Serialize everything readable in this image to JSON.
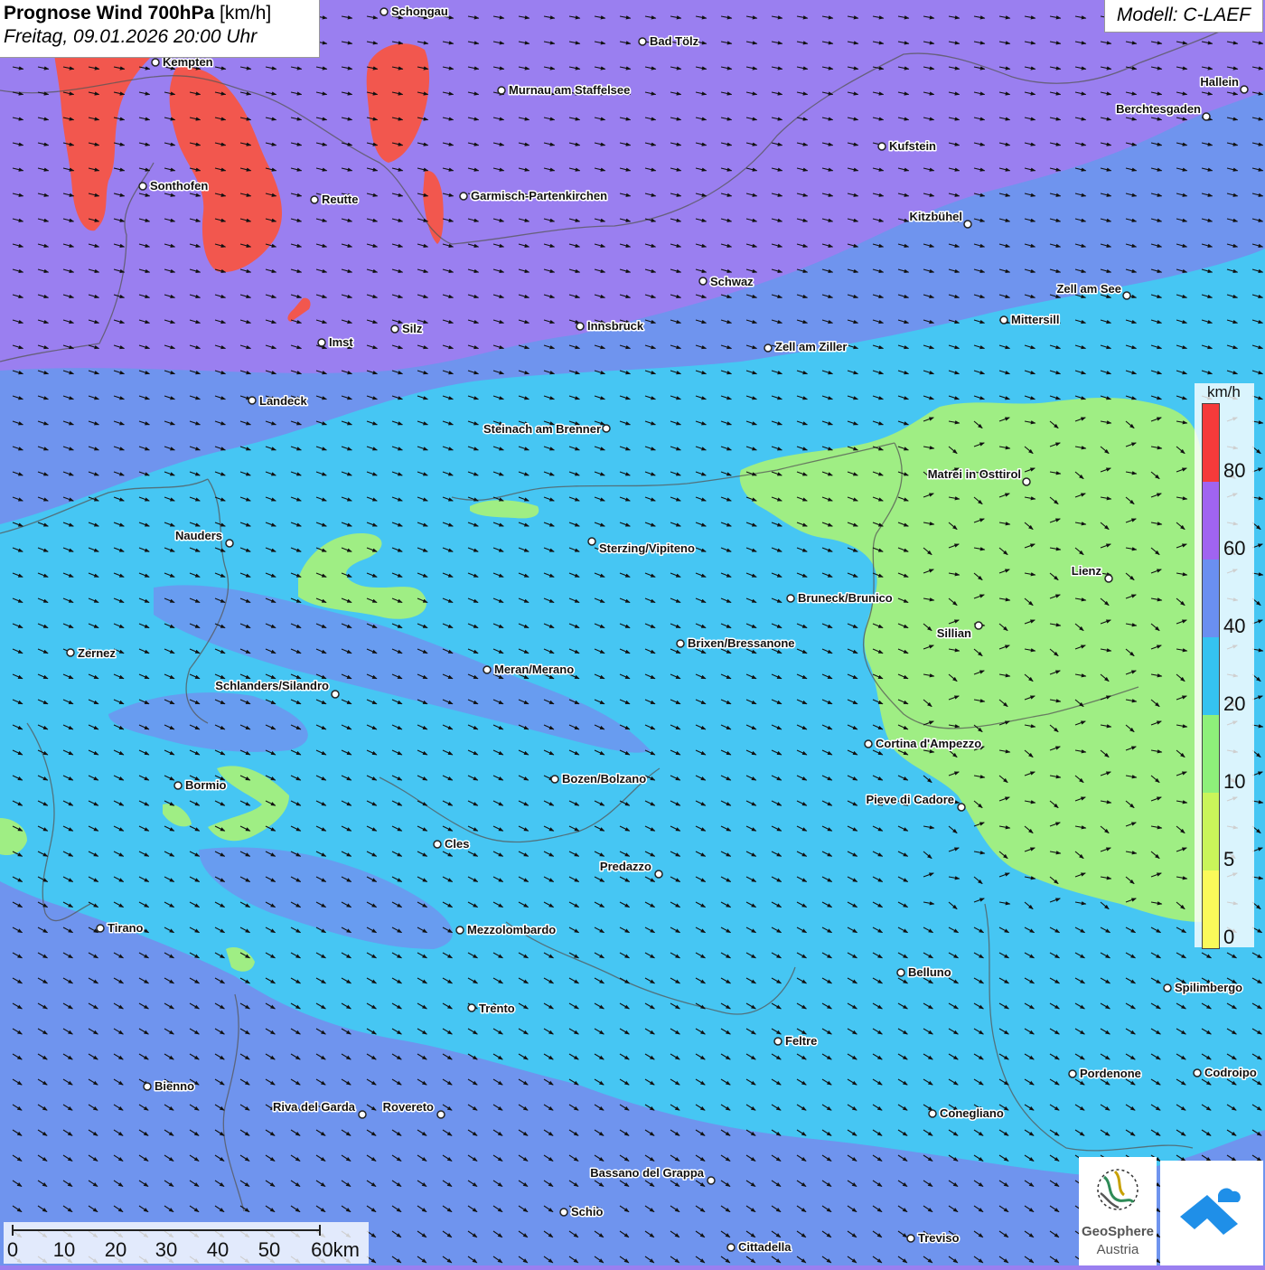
{
  "header": {
    "title_bold": "Prognose Wind 700hPa",
    "title_unit": "[km/h]",
    "subtitle": "Freitag, 09.01.2026 20:00 Uhr",
    "model": "Modell: C-LAEF"
  },
  "legend": {
    "unit": "km/h",
    "ticks": [
      "80",
      "60",
      "40",
      "20",
      "10",
      "5",
      "0"
    ],
    "colors": [
      "#f53a3a",
      "#a064f0",
      "#6a8ff0",
      "#35c3f0",
      "#8ef07a",
      "#c9f55a",
      "#fafa5a"
    ]
  },
  "colors": {
    "purple": "#9a7ff0",
    "blue": "#6f94ee",
    "cyan": "#46c6f3",
    "green": "#9fee84",
    "red": "#f2574e"
  },
  "towns": [
    {
      "name": "Schongau"
    },
    {
      "name": "Bad Tölz"
    },
    {
      "name": "Kempten"
    },
    {
      "name": "Murnau am Staffelsee"
    },
    {
      "name": "Hallein"
    },
    {
      "name": "Berchtesgaden"
    },
    {
      "name": "Kufstein"
    },
    {
      "name": "Sonthofen"
    },
    {
      "name": "Reutte"
    },
    {
      "name": "Garmisch-Partenkirchen"
    },
    {
      "name": "Kitzbühel"
    },
    {
      "name": "Schwaz"
    },
    {
      "name": "Zell am See"
    },
    {
      "name": "Mittersill"
    },
    {
      "name": "Innsbruck"
    },
    {
      "name": "Silz"
    },
    {
      "name": "Imst"
    },
    {
      "name": "Zell am Ziller"
    },
    {
      "name": "Landeck"
    },
    {
      "name": "Steinach am Brenner"
    },
    {
      "name": "Matrei in Osttirol"
    },
    {
      "name": "Nauders"
    },
    {
      "name": "Sterzing/Vipiteno"
    },
    {
      "name": "Lienz"
    },
    {
      "name": "Bruneck/Brunico"
    },
    {
      "name": "Sillian"
    },
    {
      "name": "Brixen/Bressanone"
    },
    {
      "name": "Zernez"
    },
    {
      "name": "Meran/Merano"
    },
    {
      "name": "Schlanders/Silandro"
    },
    {
      "name": "Cortina d'Ampezzo"
    },
    {
      "name": "Bozen/Bolzano"
    },
    {
      "name": "Bormio"
    },
    {
      "name": "Pieve di Cadore"
    },
    {
      "name": "Cles"
    },
    {
      "name": "Predazzo"
    },
    {
      "name": "Tirano"
    },
    {
      "name": "Mezzolombardo"
    },
    {
      "name": "Belluno"
    },
    {
      "name": "Spilimbergo"
    },
    {
      "name": "Trento"
    },
    {
      "name": "Feltre"
    },
    {
      "name": "Pordenone"
    },
    {
      "name": "Codroipo"
    },
    {
      "name": "Bienno"
    },
    {
      "name": "Riva del Garda"
    },
    {
      "name": "Rovereto"
    },
    {
      "name": "Conegliano"
    },
    {
      "name": "Bassano del Grappa"
    },
    {
      "name": "Schio"
    },
    {
      "name": "Treviso"
    },
    {
      "name": "Cittadella"
    }
  ],
  "scale": {
    "labels": [
      "0",
      "10",
      "20",
      "30",
      "40",
      "50",
      "60km"
    ]
  },
  "logos": {
    "geosphere_line1": "GeoSphere",
    "geosphere_line2": "Austria"
  }
}
